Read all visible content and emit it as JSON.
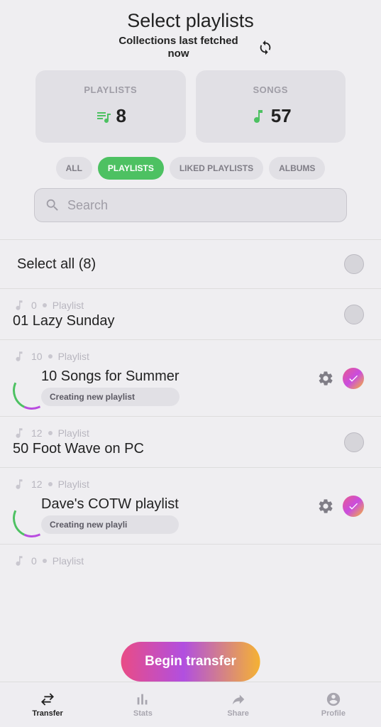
{
  "header": {
    "title": "Select playlists",
    "subtitle": "Collections last fetched now"
  },
  "stats": {
    "playlists": {
      "label": "PLAYLISTS",
      "value": "8"
    },
    "songs": {
      "label": "SONGS",
      "value": "57"
    }
  },
  "filters": {
    "all": "ALL",
    "playlists": "PLAYLISTS",
    "liked": "LIKED PLAYLISTS",
    "albums": "ALBUMS"
  },
  "search": {
    "placeholder": "Search"
  },
  "select_all": {
    "label": "Select all (8)"
  },
  "playlists": [
    {
      "count": "0",
      "type": "Playlist",
      "title": "01 Lazy Sunday",
      "selected": false,
      "creating": false
    },
    {
      "count": "10",
      "type": "Playlist",
      "title": "10 Songs for Summer",
      "selected": true,
      "creating": true,
      "status": "Creating new playlist"
    },
    {
      "count": "12",
      "type": "Playlist",
      "title": "50 Foot Wave on PC",
      "selected": false,
      "creating": false
    },
    {
      "count": "12",
      "type": "Playlist",
      "title": "Dave's COTW playlist",
      "selected": true,
      "creating": true,
      "status": "Creating new playli"
    },
    {
      "count": "0",
      "type": "Playlist",
      "title": "",
      "selected": false,
      "creating": false
    }
  ],
  "begin_btn": "Begin transfer",
  "tabs": {
    "transfer": "Transfer",
    "stats": "Stats",
    "share": "Share",
    "profile": "Profile"
  }
}
